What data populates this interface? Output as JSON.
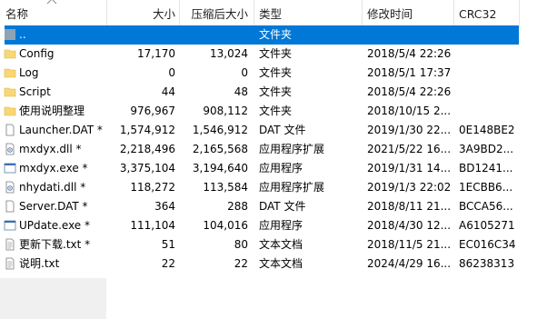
{
  "columns": {
    "name": "名称",
    "size": "大小",
    "compressed": "压缩后大小",
    "type": "类型",
    "modified": "修改时间",
    "crc": "CRC32"
  },
  "rows": [
    {
      "name": "..",
      "size": "",
      "compressed": "",
      "type": "文件夹",
      "modified": "",
      "crc": "",
      "icon": "folder-up-icon",
      "selected": true
    },
    {
      "name": "Config",
      "size": "17,170",
      "compressed": "13,024",
      "type": "文件夹",
      "modified": "2018/5/4 22:26",
      "crc": "",
      "icon": "folder-icon"
    },
    {
      "name": "Log",
      "size": "0",
      "compressed": "0",
      "type": "文件夹",
      "modified": "2018/5/1 17:37",
      "crc": "",
      "icon": "folder-icon"
    },
    {
      "name": "Script",
      "size": "44",
      "compressed": "48",
      "type": "文件夹",
      "modified": "2018/5/4 22:26",
      "crc": "",
      "icon": "folder-icon"
    },
    {
      "name": "使用说明整理",
      "size": "976,967",
      "compressed": "908,112",
      "type": "文件夹",
      "modified": "2018/10/15 2...",
      "crc": "",
      "icon": "folder-icon"
    },
    {
      "name": "Launcher.DAT *",
      "size": "1,574,912",
      "compressed": "1,546,912",
      "type": "DAT 文件",
      "modified": "2019/1/30 22...",
      "crc": "0E148BE2",
      "icon": "file-icon"
    },
    {
      "name": "mxdyx.dll *",
      "size": "2,218,496",
      "compressed": "2,165,568",
      "type": "应用程序扩展",
      "modified": "2021/5/22 16...",
      "crc": "3A9BD2...",
      "icon": "dll-icon"
    },
    {
      "name": "mxdyx.exe *",
      "size": "3,375,104",
      "compressed": "3,194,640",
      "type": "应用程序",
      "modified": "2019/1/31 14...",
      "crc": "BD1241...",
      "icon": "exe-icon"
    },
    {
      "name": "nhydati.dll *",
      "size": "118,272",
      "compressed": "113,584",
      "type": "应用程序扩展",
      "modified": "2019/1/3 22:02",
      "crc": "1ECBB6...",
      "icon": "dll-icon"
    },
    {
      "name": "Server.DAT *",
      "size": "364",
      "compressed": "288",
      "type": "DAT 文件",
      "modified": "2018/8/11 21...",
      "crc": "BCCA56...",
      "icon": "file-icon"
    },
    {
      "name": "UPdate.exe *",
      "size": "111,104",
      "compressed": "104,016",
      "type": "应用程序",
      "modified": "2018/4/30 12...",
      "crc": "A6105271",
      "icon": "exe-icon"
    },
    {
      "name": "更新下载.txt *",
      "size": "51",
      "compressed": "80",
      "type": "文本文档",
      "modified": "2018/11/5 21...",
      "crc": "EC016C34",
      "icon": "txt-icon"
    },
    {
      "name": "说明.txt",
      "size": "22",
      "compressed": "22",
      "type": "文本文档",
      "modified": "2024/4/29 16...",
      "crc": "86238313",
      "icon": "txt-icon"
    }
  ]
}
